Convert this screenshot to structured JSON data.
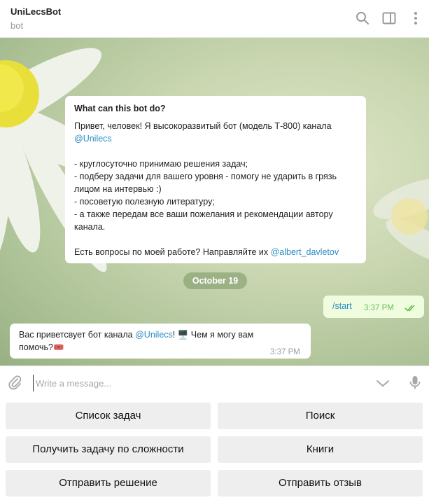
{
  "header": {
    "title": "UniLecsBot",
    "subtitle": "bot",
    "icons": [
      "search-icon",
      "sidebar-toggle-icon",
      "more-vertical-icon"
    ]
  },
  "about_card": {
    "heading": "What can this bot do?",
    "line1": "Привет, человек! Я высокоразвитый бот (модель Т-800) канала",
    "line1_link": "@Unilecs",
    "list": [
      "- круглосуточно принимаю решения задач;",
      "- подберу задачи для вашего уровня - помогу не ударить в грязь лицом на интервью :)",
      "- посоветую полезную литературу;",
      "- а также передам все ваши пожелания и рекомендации автору канала."
    ],
    "footer_text": "Есть вопросы по моей работе? Направляйте их ",
    "footer_link": "@albert_davletov"
  },
  "date_divider": "October 19",
  "outgoing_message": {
    "text": "/start",
    "time": "3:37 PM",
    "status_icon": "double-check-icon"
  },
  "incoming_message": {
    "text_before_link": "Вас приветсвует бот канала ",
    "link": "@Unilecs",
    "text_after_link": "! 🖥️ Чем я могу вам помочь?🎟️",
    "time": "3:37 PM"
  },
  "composer": {
    "placeholder": "Write a message...",
    "value": "",
    "icons": [
      "attach-icon",
      "chevron-down-icon",
      "microphone-icon"
    ]
  },
  "keyboard": {
    "buttons": [
      "Список задач",
      "Поиск",
      "Получить задачу по сложности",
      "Книги",
      "Отправить решение",
      "Отправить отзыв"
    ]
  },
  "colors": {
    "link": "#2a8cc4",
    "outgoing_bubble": "#effdde",
    "outgoing_time": "#6cbf5f",
    "button_bg": "#eeeeee"
  }
}
